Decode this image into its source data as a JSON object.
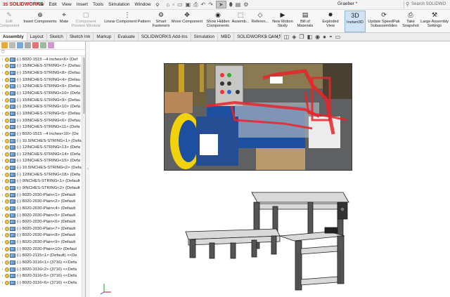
{
  "app": {
    "logo_text": "SOLIDWORKS",
    "doc_title": "Graeber *",
    "search_placeholder": "Search SOLIDWO"
  },
  "menu": [
    "File",
    "Edit",
    "View",
    "Insert",
    "Tools",
    "Simulation",
    "Window"
  ],
  "ribbon": [
    {
      "label": "Edit\nComponent",
      "icon": "edit-component-icon",
      "dim": true
    },
    {
      "label": "Insert Components",
      "icon": "insert-components-icon"
    },
    {
      "label": "Mate",
      "icon": "mate-icon"
    },
    {
      "label": "Component\nPreview Window",
      "icon": "preview-window-icon",
      "dim": true
    },
    {
      "label": "Linear Component Pattern",
      "icon": "linear-pattern-icon"
    },
    {
      "label": "Smart\nFasteners",
      "icon": "smart-fasteners-icon"
    },
    {
      "label": "Move Component",
      "icon": "move-component-icon"
    },
    {
      "label": "Show Hidden\nComponents",
      "icon": "show-hidden-icon"
    },
    {
      "label": "Assemb...",
      "icon": "assembly-features-icon"
    },
    {
      "label": "Referen...",
      "icon": "reference-geometry-icon"
    },
    {
      "label": "New Motion\nStudy",
      "icon": "motion-study-icon"
    },
    {
      "label": "Bill of\nMaterials",
      "icon": "bom-icon"
    },
    {
      "label": "Exploded View",
      "icon": "exploded-view-icon"
    },
    {
      "label": "Instant3D",
      "icon": "instant3d-icon",
      "active": true
    },
    {
      "label": "Update SpeedPak\nSubassemblies",
      "icon": "speedpak-icon"
    },
    {
      "label": "Take\nSnapshot",
      "icon": "snapshot-icon"
    },
    {
      "label": "Large Assembly\nSettings",
      "icon": "large-assembly-icon"
    }
  ],
  "tabs": [
    "Assembly",
    "Layout",
    "Sketch",
    "Sketch Ink",
    "Markup",
    "Evaluate",
    "SOLIDWORKS Add-Ins",
    "Simulation",
    "MBD",
    "SOLIDWORKS CAM"
  ],
  "tree_items": [
    "(-) 8020-1515 --4 inches<6> (Def",
    "(-) 15INCHES-STRING<7> (Defau",
    "(-) 15INCHES-STRING<8> (Defau",
    "(-) 10INCHES-STRING<4> (Defau",
    "(-) 12INCHES-STRING<9> (Defau",
    "(-) 12INCHES-STRING<10> (Defa",
    "(-) 15INCHES-STRING<9> (Defau",
    "(-) 15INCHES-STRING<10> (Defa",
    "(-) 10INCHES-STRING<5> (Defau",
    "(-) 10INCHES-STRING<6> (Defau",
    "(-) 12INCHES-STRING<11> (Defa",
    "(-) 8020-1515 --4 inches<10> (De",
    "(-) 10.5INCHES-STRING<1> (Defa",
    "(-) 12INCHES-STRING<13> (Defa",
    "(-) 12INCHES-STRING<14> (Defa",
    "(-) 12INCHES-STRING<15> (Defa",
    "(-) 10.5INCHES-STRING<2> (Defa",
    "(-) 12INCHES-STRING<18> (Defa",
    "(-) 9INCHES-STRING<1> (Default",
    "(-) 9INCHES-STRING<2> (Default",
    "(-) 8020-2030-Plain<1> (Default",
    "(-) 8020-2030-Plain<2> (Default",
    "(-) 8020-2030-Plain<4> (Default",
    "(-) 8020-2030-Plain<5> (Default",
    "(-) 8020-2030-Plain<6> (Default",
    "(-) 8020-2030-Plain<7> (Default",
    "(-) 8020-2030-Plain<8> (Default",
    "(-) 8020-2030-Plain<9> (Default",
    "(-) 8020-2030-Plain<10> (Defaul",
    "(-) 8020-2115<1> (Default) <<De",
    "(-) 8020-3116<1> (3716) <<Defa",
    "(-) 8020-3116<2> (3716) <<Defa",
    "(-) 8020-3116<5> (3716) <<Defa",
    "(-) 8020-3116<6> (3716) <<Defa"
  ],
  "colors": {
    "accent": "#d0121b",
    "active_tab": "#cfe3f5",
    "photo_red": "#e8252a",
    "machine_blue": "#1c4fa0",
    "yellow_guard": "#f2d20c"
  }
}
